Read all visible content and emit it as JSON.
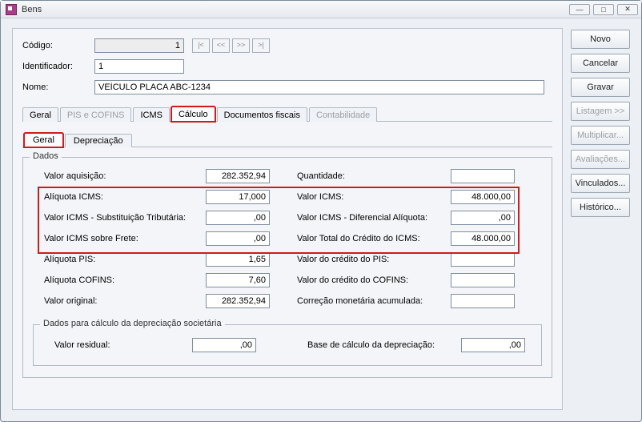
{
  "window": {
    "title": "Bens"
  },
  "header": {
    "labels": {
      "codigo": "Código:",
      "identificador": "Identificador:",
      "nome": "Nome:"
    },
    "codigo": "1",
    "identificador": "1",
    "nome": "VEÍCULO PLACA ABC-1234",
    "nav": {
      "first": "|<",
      "prev": "<<",
      "next": ">>",
      "last": ">|"
    }
  },
  "tabs": {
    "geral": "Geral",
    "pis_cofins": "PIS e COFINS",
    "icms": "ICMS",
    "calculo": "Cálculo",
    "documentos": "Documentos fiscais",
    "contabilidade": "Contabilidade"
  },
  "subtabs": {
    "geral": "Geral",
    "depreciacao": "Depreciação"
  },
  "legends": {
    "dados": "Dados",
    "dep": "Dados para cálculo da depreciação societária"
  },
  "dados": {
    "labels": {
      "valor_aquisicao": "Valor aquisição:",
      "quantidade": "Quantidade:",
      "aliquota_icms": "Alíquota ICMS:",
      "valor_icms": "Valor ICMS:",
      "valor_icms_st": "Valor ICMS - Substituição Tributária:",
      "valor_icms_dif": "Valor ICMS - Diferencial Alíquota:",
      "valor_icms_frete": "Valor ICMS sobre Frete:",
      "valor_total_credito_icms": "Valor Total do Crédito do ICMS:",
      "aliquota_pis": "Alíquota PIS:",
      "valor_credito_pis": "Valor do crédito do PIS:",
      "aliquota_cofins": "Alíquota COFINS:",
      "valor_credito_cofins": "Valor do crédito do COFINS:",
      "valor_original": "Valor original:",
      "correcao_monetaria": "Correção monetária acumulada:"
    },
    "values": {
      "valor_aquisicao": "282.352,94",
      "quantidade": "",
      "aliquota_icms": "17,000",
      "valor_icms": "48.000,00",
      "valor_icms_st": ",00",
      "valor_icms_dif": ",00",
      "valor_icms_frete": ",00",
      "valor_total_credito_icms": "48.000,00",
      "aliquota_pis": "1,65",
      "valor_credito_pis": "",
      "aliquota_cofins": "7,60",
      "valor_credito_cofins": "",
      "valor_original": "282.352,94",
      "correcao_monetaria": ""
    }
  },
  "dep": {
    "labels": {
      "valor_residual": "Valor residual:",
      "base_calculo": "Base de cálculo da depreciação:"
    },
    "values": {
      "valor_residual": ",00",
      "base_calculo": ",00"
    }
  },
  "buttons": {
    "novo": "Novo",
    "cancelar": "Cancelar",
    "gravar": "Gravar",
    "listagem": "Listagem >>",
    "multiplicar": "Multiplicar...",
    "avaliacoes": "Avaliações...",
    "vinculados": "Vinculados...",
    "historico": "Histórico..."
  }
}
